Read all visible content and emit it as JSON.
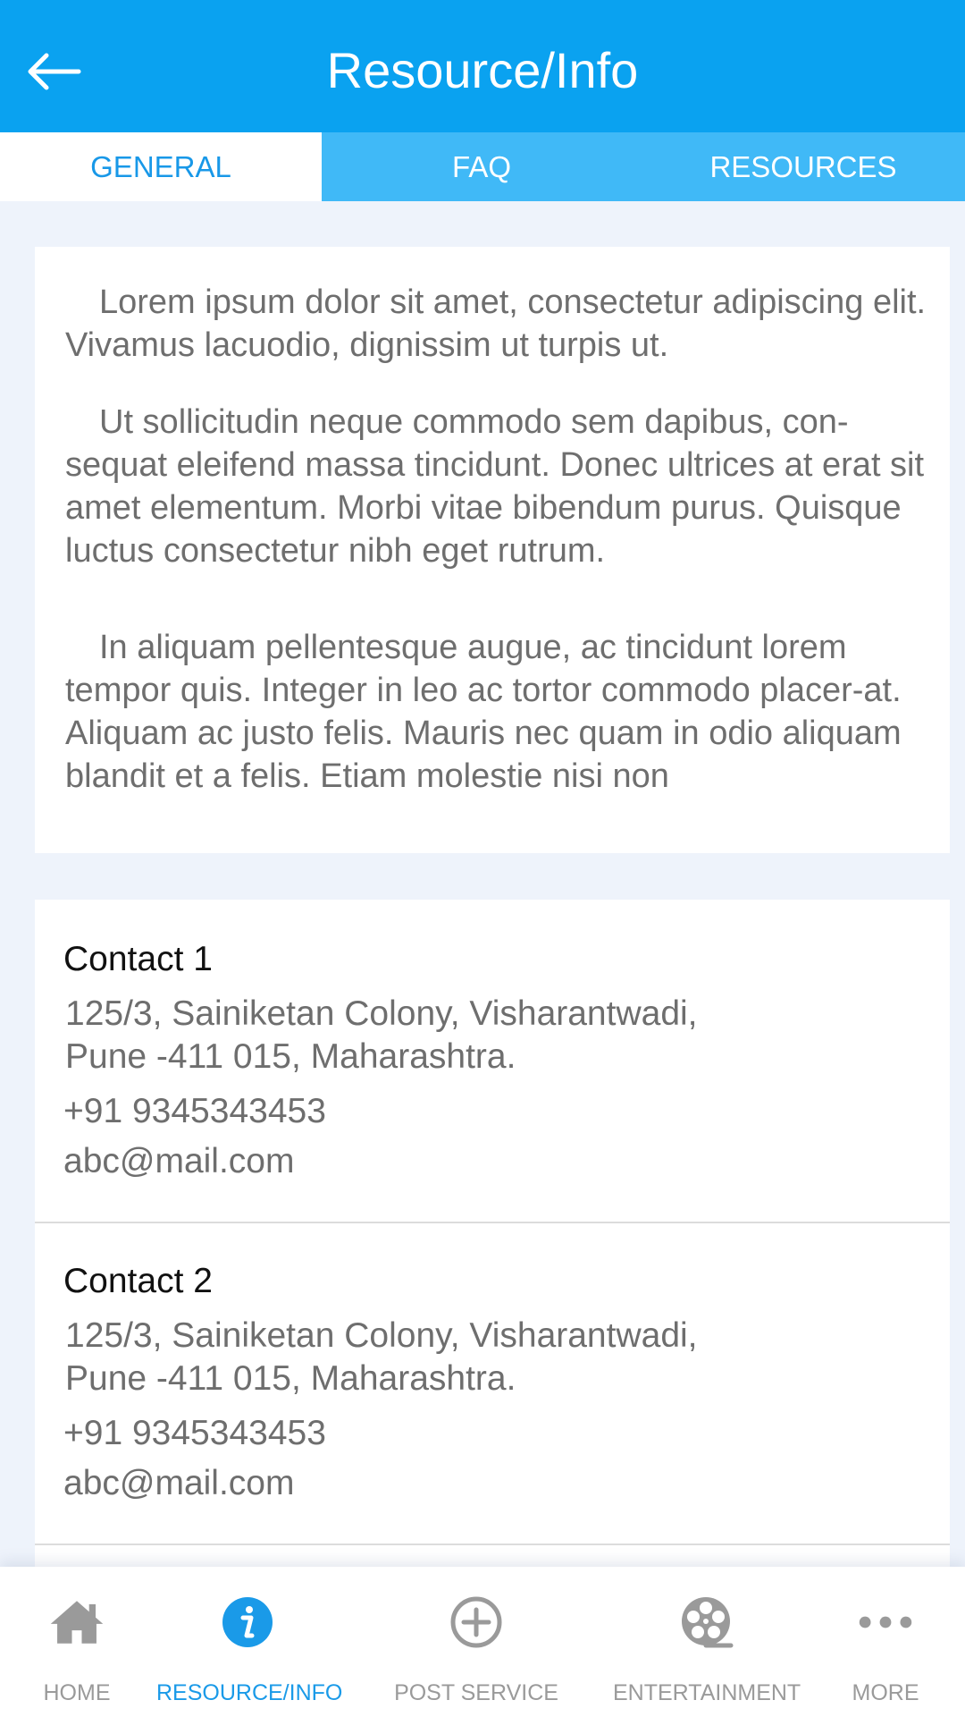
{
  "header": {
    "title": "Resource/Info",
    "back_icon": "arrow-left-icon"
  },
  "tabs": [
    {
      "label": "GENERAL",
      "active": true
    },
    {
      "label": "FAQ",
      "active": false
    },
    {
      "label": "RESOURCES",
      "active": false
    }
  ],
  "about": {
    "paragraphs": [
      "Lorem ipsum dolor sit amet, consectetur adipiscing elit. Vivamus lacuodio, dignissim ut turpis ut.",
      "Ut sollicitudin neque commodo sem dapibus, con-sequat eleifend massa tincidunt. Donec ultrices at erat sit amet elementum. Morbi vitae bibendum purus. Quisque luctus consectetur nibh eget rutrum.",
      "In aliquam pellentesque augue, ac tincidunt lorem tempor quis. Integer in leo ac tortor commodo placer-at. Aliquam ac justo felis. Mauris nec quam in odio aliquam blandit et a felis. Etiam molestie nisi non"
    ]
  },
  "contacts": [
    {
      "name": "Contact 1",
      "address_line1": "125/3, Sainiketan Colony, Visharantwadi,",
      "address_line2": "Pune -411 015, Maharashtra.",
      "phone": "+91 9345343453",
      "email": "abc@mail.com"
    },
    {
      "name": "Contact 2",
      "address_line1": "125/3, Sainiketan Colony, Visharantwadi,",
      "address_line2": "Pune -411 015, Maharashtra.",
      "phone": "+91 9345343453",
      "email": "abc@mail.com"
    }
  ],
  "bottom_nav": [
    {
      "label": "HOME",
      "icon": "home-icon",
      "active": false
    },
    {
      "label": "RESOURCE/INFO",
      "icon": "info-icon",
      "active": true
    },
    {
      "label": "POST SERVICE",
      "icon": "plus-circle-icon",
      "active": false
    },
    {
      "label": "ENTERTAINMENT",
      "icon": "film-reel-icon",
      "active": false
    },
    {
      "label": "MORE",
      "icon": "more-dots-icon",
      "active": false
    }
  ],
  "colors": {
    "primary": "#0aa2f0",
    "tab_bar": "#40b9f7",
    "active_text": "#1a9ae8",
    "inactive_nav": "#9a9a9a",
    "body_text": "#6e6e6e",
    "background": "#eef3fb"
  }
}
